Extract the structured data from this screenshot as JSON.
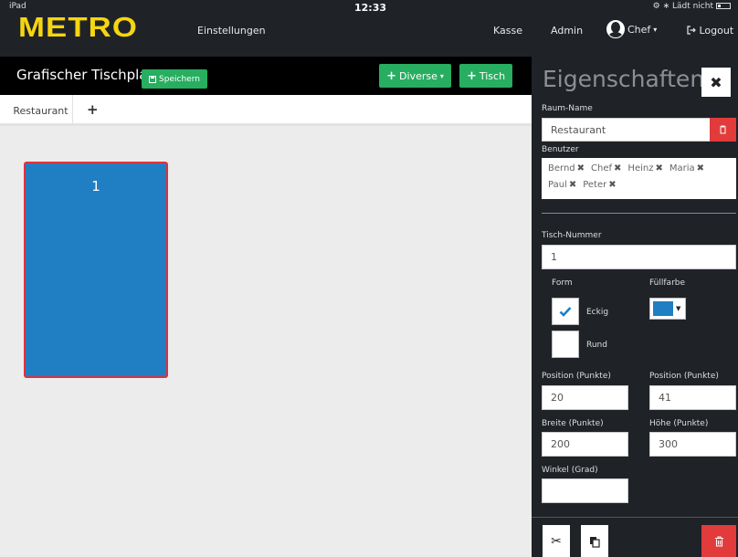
{
  "status_bar": {
    "device": "iPad",
    "time": "12:33",
    "battery_text": "⚙ ∗ Lädt nicht"
  },
  "nav": {
    "logo": "METRO",
    "einstellungen": "Einstellungen",
    "kasse": "Kasse",
    "admin": "Admin",
    "user": "Chef",
    "logout": "Logout"
  },
  "toolbar": {
    "title": "Grafischer Tischplan",
    "save_label": "Speichern",
    "diverse_label": "Diverse",
    "tisch_label": "Tisch"
  },
  "tabs": {
    "active": "Restaurant",
    "add": "+"
  },
  "tables": [
    {
      "number": "1",
      "fill_color": "#1f7fc2",
      "selected": true
    }
  ],
  "panel": {
    "title": "Eigenschaften",
    "raum_name_label": "Raum-Name",
    "raum_name_value": "Restaurant",
    "benutzer_label": "Benutzer",
    "users": [
      "Bernd",
      "Chef",
      "Heinz",
      "Maria",
      "Paul",
      "Peter"
    ],
    "tisch_nummer_label": "Tisch-Nummer",
    "tisch_nummer_value": "1",
    "form_label": "Form",
    "form_option_eckig": "Eckig",
    "form_option_rund": "Rund",
    "form_selected": "Eckig",
    "fuellfarbe_label": "Füllfarbe",
    "fuellfarbe_value": "#1f7fc2",
    "position_x_label": "Position (Punkte)",
    "position_x_value": "20",
    "position_y_label": "Position (Punkte)",
    "position_y_value": "41",
    "breite_label": "Breite (Punkte)",
    "breite_value": "200",
    "hoehe_label": "Höhe (Punkte)",
    "hoehe_value": "300",
    "winkel_label": "Winkel (Grad)",
    "winkel_value": ""
  },
  "colors": {
    "accent_green": "#27ae60",
    "danger_red": "#e23b3b",
    "logo_yellow": "#f6d511",
    "dark_bg": "#1f2328"
  }
}
